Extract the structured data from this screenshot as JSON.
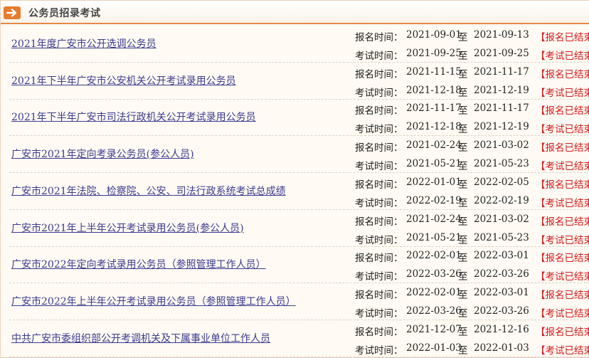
{
  "header": {
    "title": "公务员招录考试",
    "icon": "arrow-right-icon",
    "accent": "#e57c2e"
  },
  "labels": {
    "signup": "报名时间：",
    "exam": "考试时间：",
    "to": "至"
  },
  "items": [
    {
      "name": "2021年度广安市公开选调公务员",
      "signup_start": "2021-09-01",
      "signup_end": "2021-09-13",
      "signup_status": "【报名已结束",
      "exam_start": "2021-09-25",
      "exam_end": "2021-09-25",
      "exam_status": "【考试已结束"
    },
    {
      "name": "2021年下半年广安市公安机关公开考试录用公务员",
      "signup_start": "2021-11-15",
      "signup_end": "2021-11-17",
      "signup_status": "【报名已结束",
      "exam_start": "2021-12-18",
      "exam_end": "2021-12-19",
      "exam_status": "【考试已结束"
    },
    {
      "name": "2021年下半年广安市司法行政机关公开考试录用公务员",
      "signup_start": "2021-11-17",
      "signup_end": "2021-11-17",
      "signup_status": "【报名已结束",
      "exam_start": "2021-12-18",
      "exam_end": "2021-12-19",
      "exam_status": "【考试已结束"
    },
    {
      "name": "广安市2021年定向考录公务员(参公人员)",
      "signup_start": "2021-02-24",
      "signup_end": "2021-03-02",
      "signup_status": "【报名已结束",
      "exam_start": "2021-05-21",
      "exam_end": "2021-05-23",
      "exam_status": "【考试已结束"
    },
    {
      "name": "广安市2021年法院、检察院、公安、司法行政系统考试总成绩",
      "signup_start": "2022-01-01",
      "signup_end": "2022-02-05",
      "signup_status": "【报名已结束",
      "exam_start": "2022-02-19",
      "exam_end": "2022-02-19",
      "exam_status": "【考试已结束"
    },
    {
      "name": "广安市2021年上半年公开考试录用公务员(参公人员)",
      "signup_start": "2021-02-24",
      "signup_end": "2021-03-02",
      "signup_status": "【报名已结束",
      "exam_start": "2021-05-21",
      "exam_end": "2021-05-23",
      "exam_status": "【考试已结束"
    },
    {
      "name": "广安市2022年定向考试录用公务员（参照管理工作人员）",
      "signup_start": "2022-02-01",
      "signup_end": "2022-03-01",
      "signup_status": "【报名已结束",
      "exam_start": "2022-03-26",
      "exam_end": "2022-03-26",
      "exam_status": "【考试已结束"
    },
    {
      "name": "广安市2022年上半年公开考试录用公务员（参照管理工作人员）",
      "signup_start": "2022-02-01",
      "signup_end": "2022-03-01",
      "signup_status": "【报名已结束",
      "exam_start": "2022-03-26",
      "exam_end": "2022-03-26",
      "exam_status": "【考试已结束"
    },
    {
      "name": "中共广安市委组织部公开考调机关及下属事业单位工作人员",
      "signup_start": "2021-12-07",
      "signup_end": "2021-12-16",
      "signup_status": "【报名已结束",
      "exam_start": "2022-01-03",
      "exam_end": "2022-01-03",
      "exam_status": "【考试已结束"
    }
  ]
}
